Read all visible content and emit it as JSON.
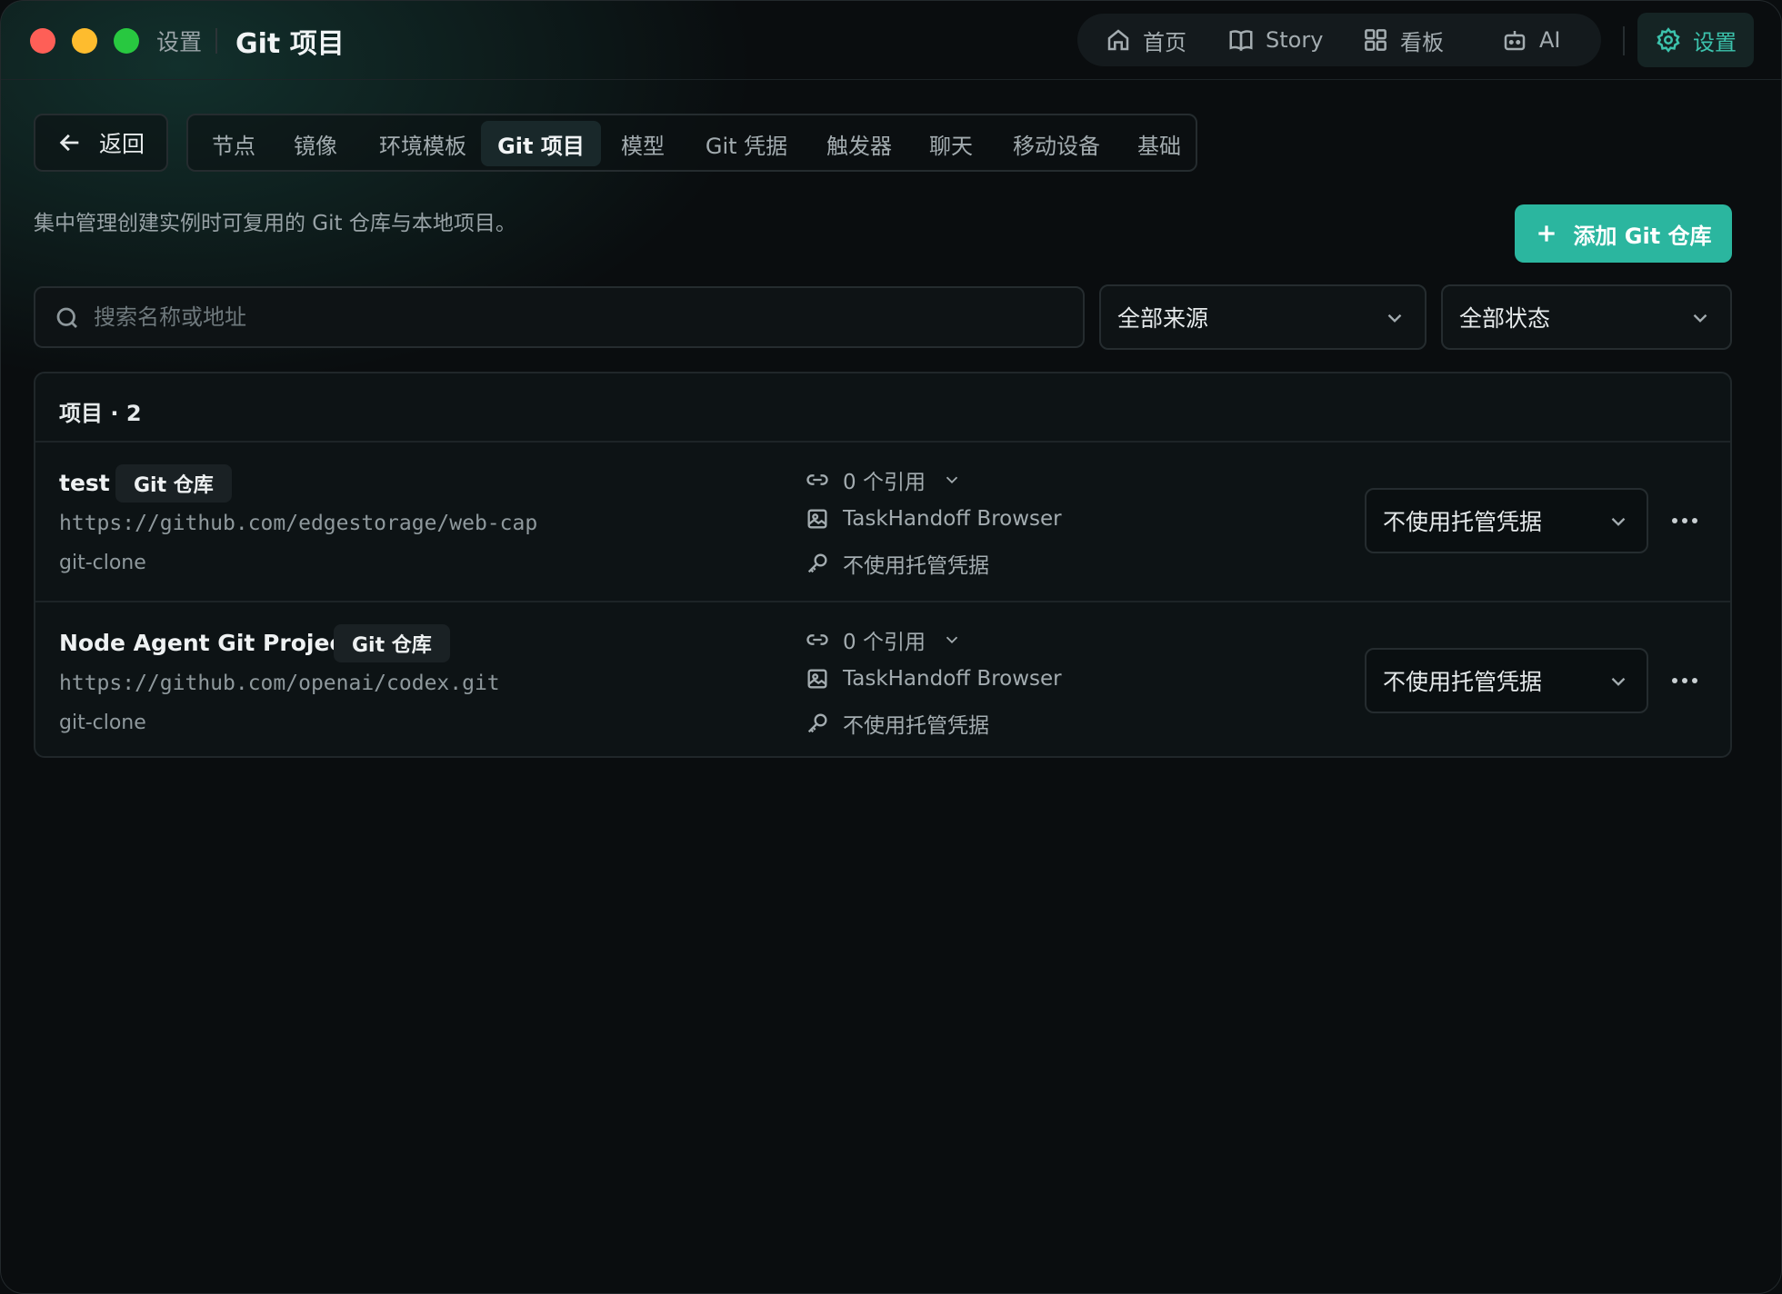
{
  "window": {
    "breadcrumb_parent": "设置",
    "breadcrumb_current": "Git 项目"
  },
  "topnav": {
    "items": [
      {
        "label": "首页",
        "icon": "home-icon"
      },
      {
        "label": "Story",
        "icon": "book-icon"
      },
      {
        "label": "看板",
        "icon": "grid-icon"
      },
      {
        "label": "AI",
        "icon": "bot-icon"
      }
    ],
    "settings_label": "设置",
    "accent_color": "#3cc3ad"
  },
  "back_label": "返回",
  "tabs": [
    {
      "label": "节点",
      "active": false
    },
    {
      "label": "镜像",
      "active": false
    },
    {
      "label": "环境模板",
      "active": false
    },
    {
      "label": "Git 项目",
      "active": true
    },
    {
      "label": "模型",
      "active": false
    },
    {
      "label": "Git 凭据",
      "active": false
    },
    {
      "label": "触发器",
      "active": false
    },
    {
      "label": "聊天",
      "active": false
    },
    {
      "label": "移动设备",
      "active": false
    },
    {
      "label": "基础",
      "active": false
    }
  ],
  "description": "集中管理创建实例时可复用的 Git 仓库与本地项目。",
  "add_button_label": "添加 Git 仓库",
  "add_button_color": "#2bb69f",
  "filters": {
    "search_placeholder": "搜索名称或地址",
    "search_value": "",
    "source_selected": "全部来源",
    "status_selected": "全部状态"
  },
  "projects_panel": {
    "title": "项目 · 2",
    "rows": [
      {
        "name": "test",
        "badge": "Git 仓库",
        "url": "https://github.com/edgestorage/web-cap",
        "method": "git-clone",
        "references": "0 个引用",
        "environment": "TaskHandoff Browser",
        "credential": "不使用托管凭据",
        "credential_select": "不使用托管凭据"
      },
      {
        "name": "Node Agent Git Project",
        "badge": "Git 仓库",
        "url": "https://github.com/openai/codex.git",
        "method": "git-clone",
        "references": "0 个引用",
        "environment": "TaskHandoff Browser",
        "credential": "不使用托管凭据",
        "credential_select": "不使用托管凭据"
      }
    ]
  }
}
